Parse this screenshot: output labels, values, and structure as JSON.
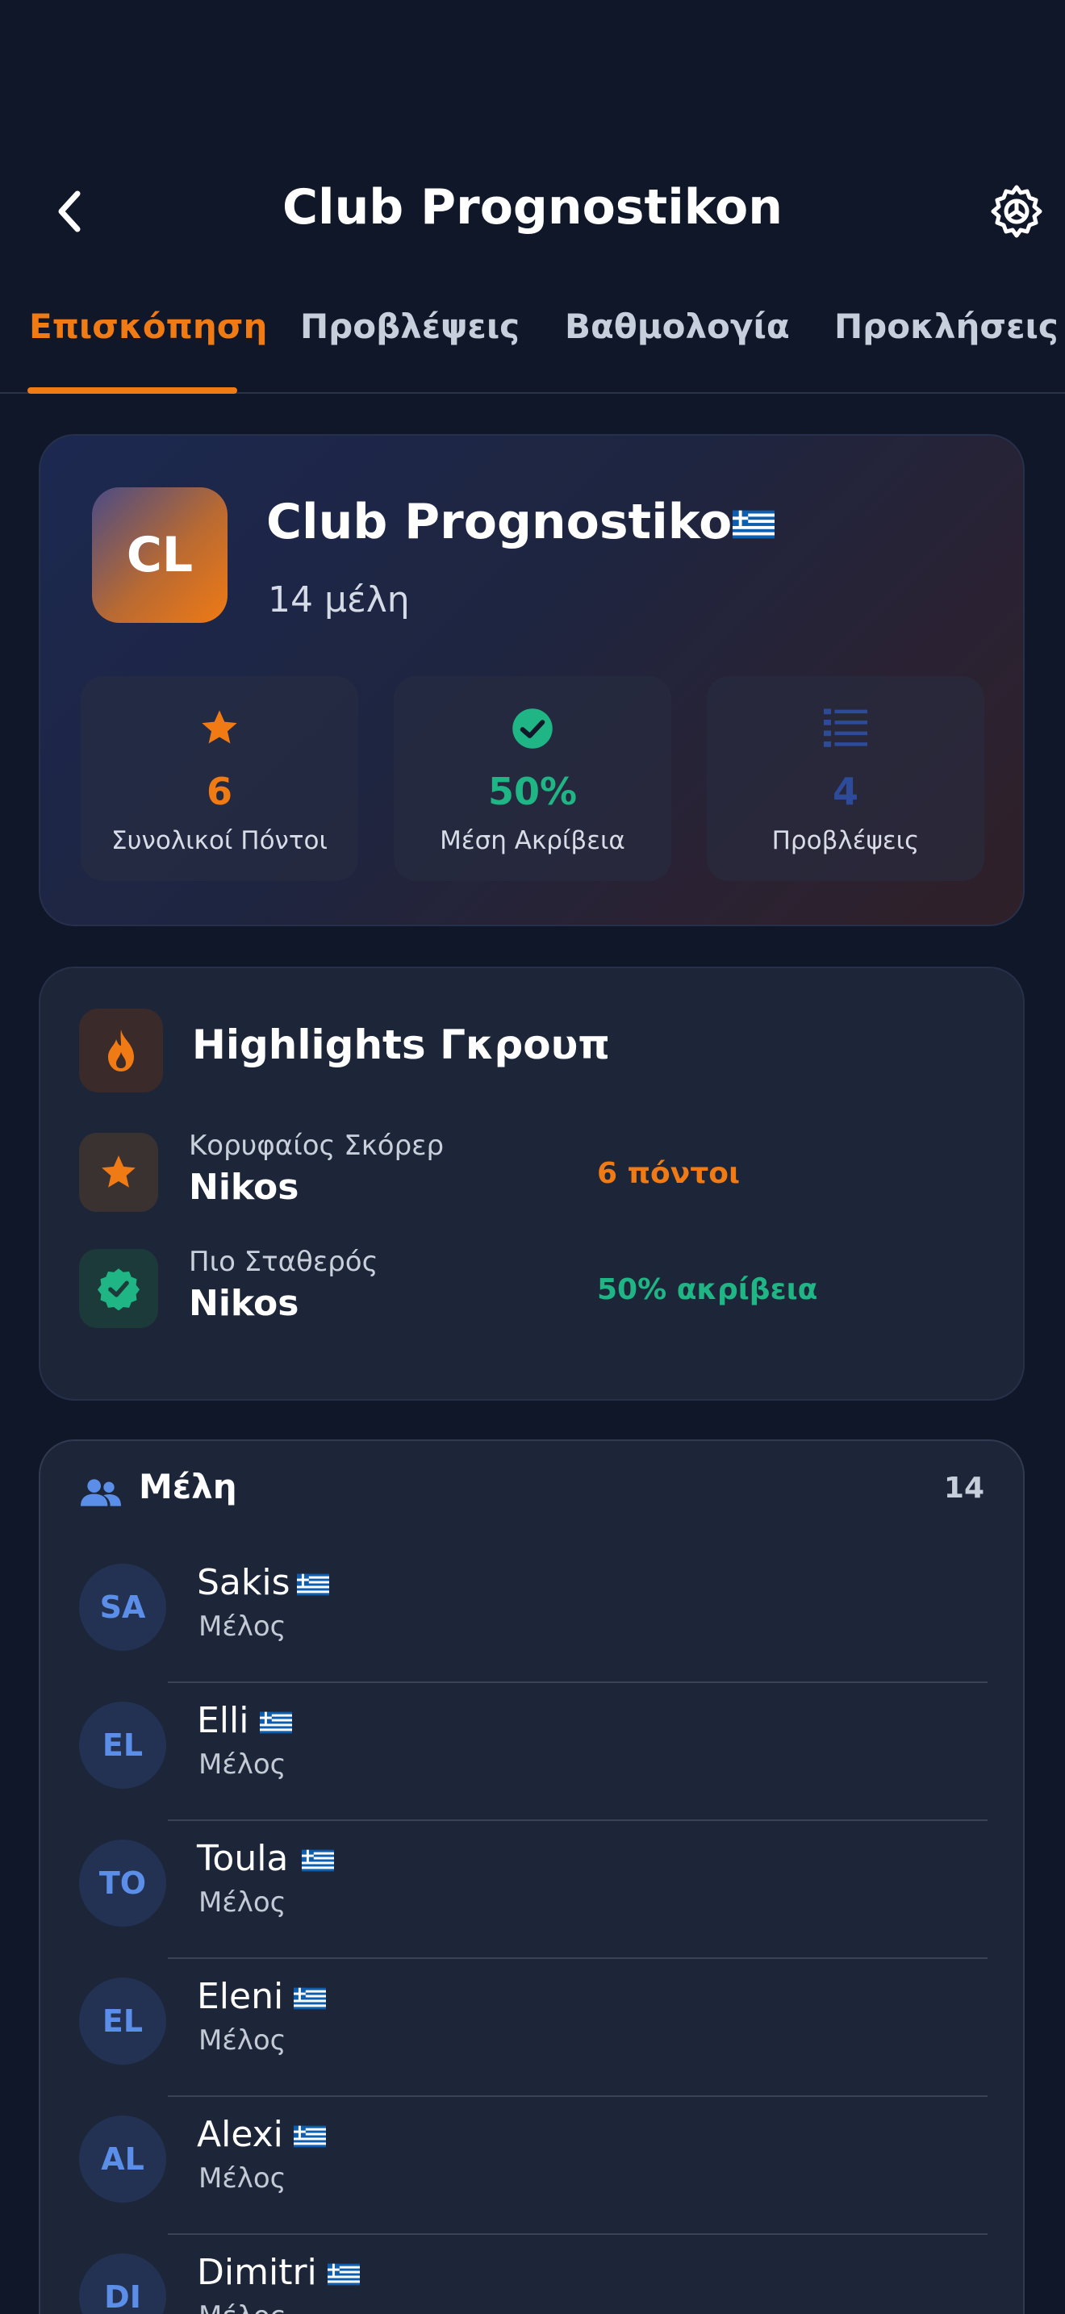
{
  "header": {
    "title": "Club Prognostikon",
    "back_icon": "chevron-left-icon",
    "settings_icon": "gear-icon"
  },
  "tabs": [
    {
      "label": "Επισκόπηση",
      "active": true
    },
    {
      "label": "Προβλέψεις",
      "active": false
    },
    {
      "label": "Βαθμολογία",
      "active": false
    },
    {
      "label": "Προκλήσεις",
      "active": false
    }
  ],
  "club": {
    "initials": "CL",
    "name": "Club Prognostikon",
    "flag_icon": "greek-flag-icon",
    "members_text": "14 μέλη"
  },
  "stats": [
    {
      "icon": "star-icon",
      "value": "6",
      "label": "Συνολικοί Πόντοι",
      "color": "#f07a14"
    },
    {
      "icon": "check-circle-icon",
      "value": "50%",
      "label": "Μέση Ακρίβεια",
      "color": "#1fb584"
    },
    {
      "icon": "list-icon",
      "value": "4",
      "label": "Προβλέψεις",
      "color": "#2e4b9a"
    }
  ],
  "highlights": {
    "title": "Highlights Γκρουπ",
    "icon": "flame-icon",
    "items": [
      {
        "icon": "star-icon",
        "label": "Κορυφαίος Σκόρερ",
        "name": "Nikos",
        "value": "6 πόντοι",
        "color": "#f07a14"
      },
      {
        "icon": "verified-badge-icon",
        "label": "Πιο Σταθερός",
        "name": "Nikos",
        "value": "50% ακρίβεια",
        "color": "#1fb584"
      }
    ]
  },
  "members": {
    "title": "Μέλη",
    "icon": "people-icon",
    "count": "14",
    "list": [
      {
        "initials": "SA",
        "name": "Sakis",
        "role": "Μέλος"
      },
      {
        "initials": "EL",
        "name": "Elli",
        "role": "Μέλος"
      },
      {
        "initials": "TO",
        "name": "Toula",
        "role": "Μέλος"
      },
      {
        "initials": "EL",
        "name": "Eleni",
        "role": "Μέλος"
      },
      {
        "initials": "AL",
        "name": "Alexi",
        "role": "Μέλος"
      },
      {
        "initials": "DI",
        "name": "Dimitri",
        "role": "Μέλος"
      }
    ]
  },
  "colors": {
    "background": "#0f1729",
    "card": "#1d2638",
    "accent_orange": "#f07a14",
    "accent_green": "#1fb584",
    "accent_blue": "#5b8ee8"
  }
}
